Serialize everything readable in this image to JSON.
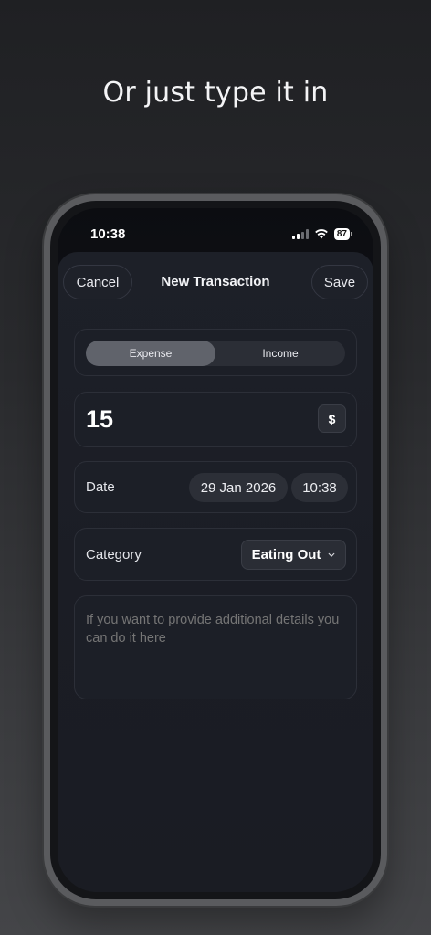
{
  "headline": "Or just type it in",
  "status_bar": {
    "time": "10:38",
    "battery": "87"
  },
  "nav": {
    "cancel_label": "Cancel",
    "title": "New Transaction",
    "save_label": "Save"
  },
  "type_toggle": {
    "options": [
      "Expense",
      "Income"
    ],
    "selected": "Expense"
  },
  "amount": {
    "value": "15",
    "currency_symbol": "$"
  },
  "date_row": {
    "label": "Date",
    "date": "29 Jan 2026",
    "time": "10:38"
  },
  "category_row": {
    "label": "Category",
    "value": "Eating Out"
  },
  "notes": {
    "placeholder": "If you want to provide additional details you can do it here"
  },
  "colors": {
    "background_top": "#1f2023",
    "background_bottom": "#444548",
    "sheet": "#1c1f27",
    "segment_active": "#60636b"
  },
  "icons": {
    "wifi": "wifi-icon",
    "signal": "cellular-signal-icon",
    "battery": "battery-icon",
    "category_chevron": "chevron-down-icon"
  }
}
